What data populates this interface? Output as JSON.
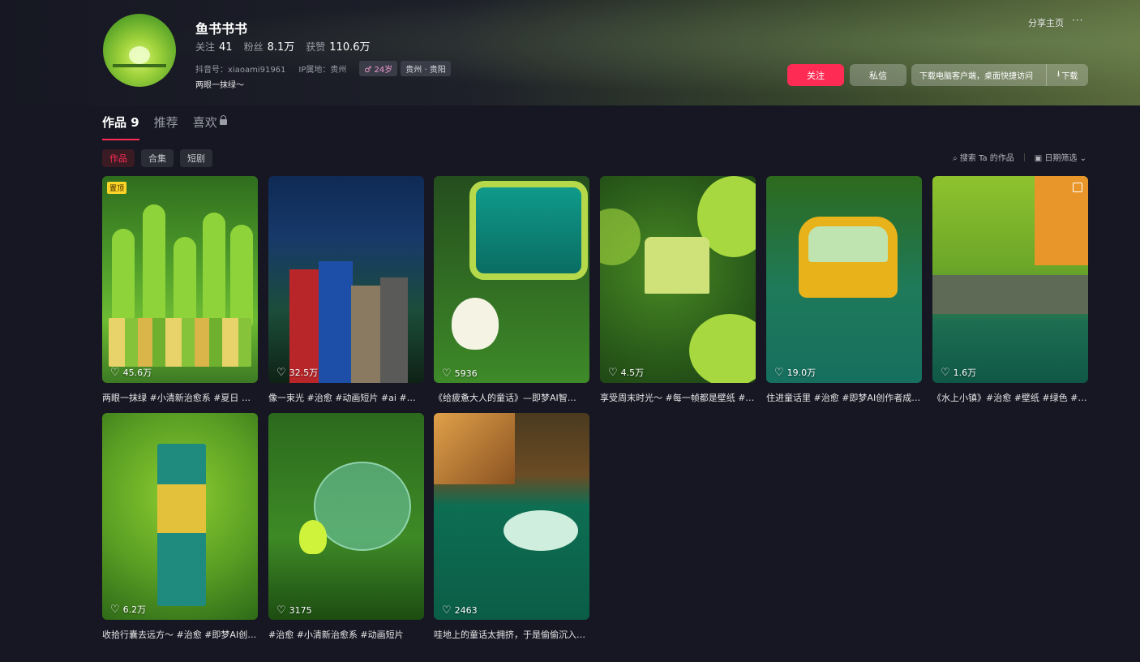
{
  "profile": {
    "name": "鱼书书书",
    "stats": [
      {
        "label": "关注",
        "value": "41"
      },
      {
        "label": "粉丝",
        "value": "8.1万"
      },
      {
        "label": "获赞",
        "value": "110.6万"
      }
    ],
    "douyin_id": "抖音号：xiaoami91961",
    "ip": "IP属地：贵州",
    "age_tag": "♂ 24岁",
    "location_tag": "贵州 · 贵阳",
    "bio": "两眼一抹绿～"
  },
  "header": {
    "share_label": "分享主页",
    "more_label": "···",
    "follow_label": "关注",
    "message_label": "私信",
    "download_prompt": "下载电脑客户端，桌面快捷访问",
    "download_label": "下载"
  },
  "tabs": [
    {
      "label": "作品 9",
      "active": true
    },
    {
      "label": "推荐",
      "active": false
    },
    {
      "label": "喜欢",
      "active": false
    }
  ],
  "subtabs": [
    {
      "label": "作品",
      "active": true
    },
    {
      "label": "合集",
      "active": false
    },
    {
      "label": "短剧",
      "active": false
    }
  ],
  "tools": {
    "search_label": "搜索 Ta 的作品",
    "filter_label": "日期筛选"
  },
  "videos": [
    {
      "likes": "45.6万",
      "caption": "两眼一抹绿 #小清新治愈系 #夏日 #…",
      "pinned": "置顶"
    },
    {
      "likes": "32.5万",
      "caption": "像一束光 #治愈 #动画短片 #ai #自然"
    },
    {
      "likes": "5936",
      "caption": "《给疲惫大人的童话》—即梦AI智…"
    },
    {
      "likes": "4.5万",
      "caption": "享受周末时光～ #每一帧都是壁纸 #…"
    },
    {
      "likes": "19.0万",
      "caption": "住进童话里 #治愈 #即梦AI创作者成…"
    },
    {
      "likes": "1.6万",
      "caption": "《水上小镇》#治愈 #壁纸 #绿色 #慢…"
    },
    {
      "likes": "6.2万",
      "caption": "收拾行囊去远方～ #治愈 #即梦AI创…"
    },
    {
      "likes": "3175",
      "caption": "#治愈 #小清新治愈系 #动画短片"
    },
    {
      "likes": "2463",
      "caption": "哇地上的童话太拥挤，于是偷偷沉入…"
    }
  ],
  "colors": {
    "accent": "#fe2c55",
    "background": "#161722",
    "pin_badge": "#fdd428"
  }
}
